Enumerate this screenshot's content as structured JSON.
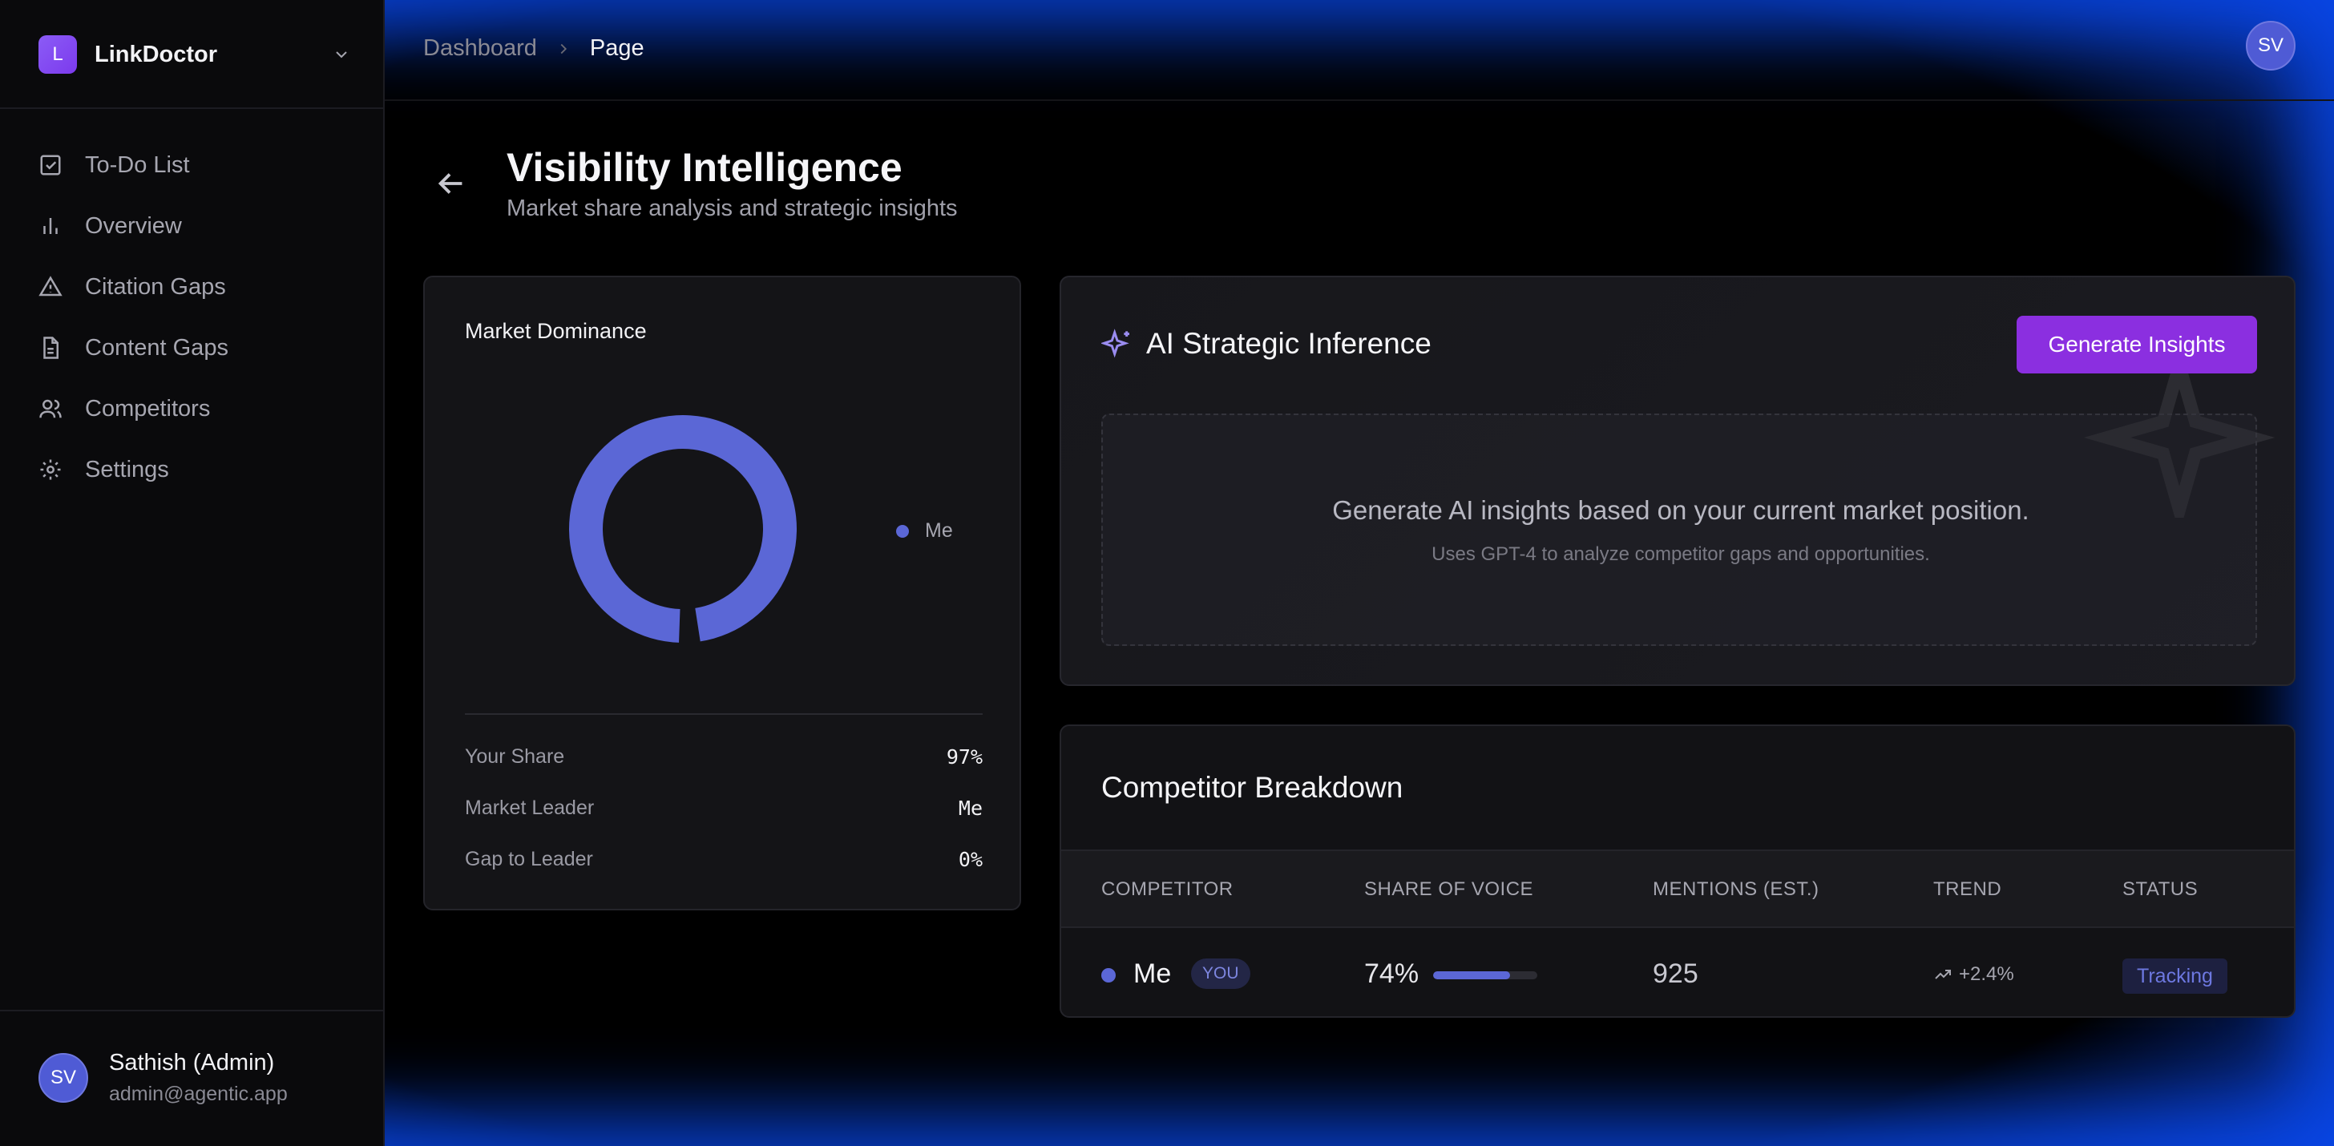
{
  "brand": {
    "logo_letter": "L",
    "name": "LinkDoctor"
  },
  "sidebar": {
    "items": [
      {
        "label": "To-Do List",
        "icon": "checkbox-icon"
      },
      {
        "label": "Overview",
        "icon": "bar-chart-icon"
      },
      {
        "label": "Citation Gaps",
        "icon": "warning-icon"
      },
      {
        "label": "Content Gaps",
        "icon": "document-icon"
      },
      {
        "label": "Competitors",
        "icon": "users-icon"
      },
      {
        "label": "Settings",
        "icon": "gear-icon"
      }
    ],
    "user": {
      "initials": "SV",
      "name": "Sathish (Admin)",
      "email": "admin@agentic.app"
    }
  },
  "topbar": {
    "breadcrumb": [
      "Dashboard",
      "Page"
    ],
    "avatar_initials": "SV"
  },
  "header": {
    "title": "Visibility Intelligence",
    "subtitle": "Market share analysis and strategic insights"
  },
  "market": {
    "title": "Market Dominance",
    "legend": "Me",
    "stats": [
      {
        "label": "Your Share",
        "value": "97%"
      },
      {
        "label": "Market Leader",
        "value": "Me"
      },
      {
        "label": "Gap to Leader",
        "value": "0%"
      }
    ]
  },
  "chart_data": {
    "type": "pie",
    "categories": [
      "Me"
    ],
    "values": [
      97
    ],
    "title": "Market Dominance",
    "legend": [
      "Me"
    ],
    "legend_position": "right",
    "colors": [
      "#5b67d6"
    ]
  },
  "ai": {
    "title": "AI Strategic Inference",
    "button": "Generate Insights",
    "main_text": "Generate AI insights based on your current market position.",
    "note": "Uses GPT-4 to analyze competitor gaps and opportunities."
  },
  "competitors": {
    "title": "Competitor Breakdown",
    "columns": [
      "COMPETITOR",
      "SHARE OF VOICE",
      "MENTIONS (EST.)",
      "TREND",
      "STATUS"
    ],
    "rows": [
      {
        "name": "Me",
        "badge": "YOU",
        "share": "74%",
        "share_fraction": 0.74,
        "mentions": "925",
        "trend": "+2.4%",
        "status": "Tracking"
      }
    ]
  },
  "colors": {
    "accent": "#5b67d6",
    "button": "#8b2fe0",
    "background": "#000000"
  }
}
